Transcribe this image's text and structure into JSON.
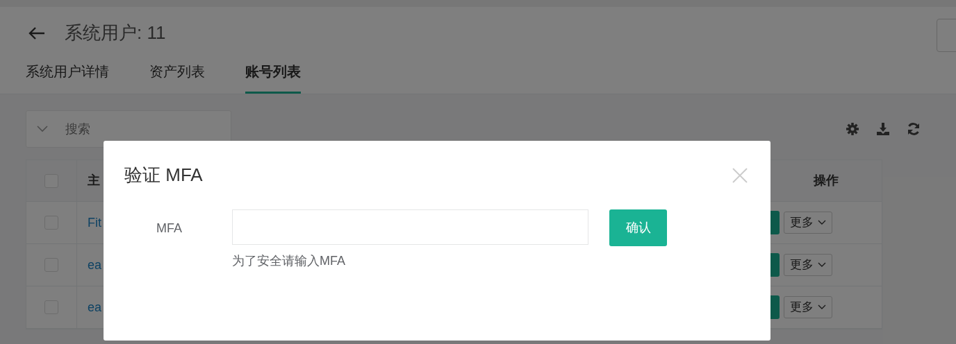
{
  "header": {
    "title": "系统用户: 11"
  },
  "tabs": [
    {
      "label": "系统用户详情",
      "selected": false
    },
    {
      "label": "资产列表",
      "selected": false
    },
    {
      "label": "账号列表",
      "selected": true
    }
  ],
  "search": {
    "placeholder": "搜索"
  },
  "table": {
    "header_checked": false,
    "columns": [
      "主",
      "操作"
    ],
    "rows": [
      {
        "checked": false,
        "name": "Fit",
        "more": "更多"
      },
      {
        "checked": false,
        "name": "ea",
        "more": "更多"
      },
      {
        "checked": false,
        "name": "ea",
        "more": "更多"
      }
    ]
  },
  "dialog": {
    "title": "验证 MFA",
    "field_label": "MFA",
    "help": "为了安全请输入MFA",
    "confirm": "确认"
  }
}
